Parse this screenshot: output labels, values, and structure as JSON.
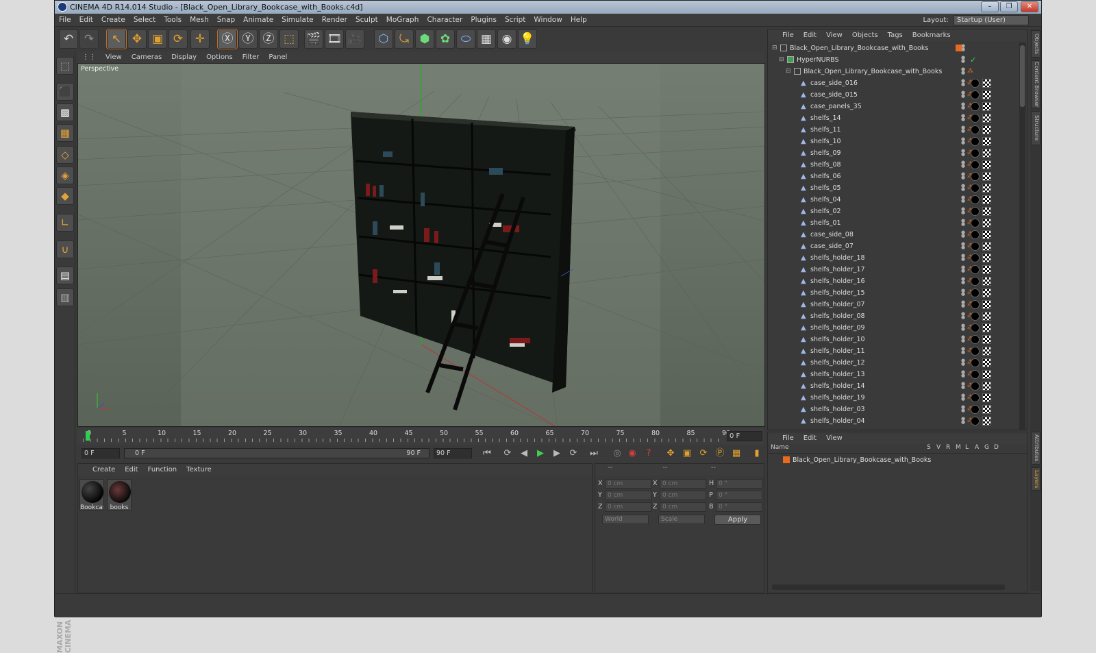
{
  "window": {
    "title": "CINEMA 4D R14.014 Studio - [Black_Open_Library_Bookcase_with_Books.c4d]",
    "controls": [
      "–",
      "❐",
      "✕"
    ]
  },
  "menubar": [
    "File",
    "Edit",
    "Create",
    "Select",
    "Tools",
    "Mesh",
    "Snap",
    "Animate",
    "Simulate",
    "Render",
    "Sculpt",
    "MoGraph",
    "Character",
    "Plugins",
    "Script",
    "Window",
    "Help"
  ],
  "layout": {
    "label": "Layout:",
    "value": "Startup (User)"
  },
  "toolbar": {
    "undo": "↶",
    "redo": "↷",
    "tools": [
      "↖",
      "✥",
      "▣",
      "⟳",
      "✛",
      "Ⓧ",
      "Ⓨ",
      "Ⓩ",
      "⬚",
      "🎬",
      "🎞",
      "🎥",
      "⬡",
      "⤿",
      "⬢",
      "✿",
      "⬭",
      "▦",
      "◉",
      "💡"
    ]
  },
  "viewport": {
    "menu": [
      "View",
      "Cameras",
      "Display",
      "Options",
      "Filter",
      "Panel"
    ],
    "label": "Perspective"
  },
  "timeline": {
    "ticks": [
      "0",
      "5",
      "10",
      "15",
      "20",
      "25",
      "30",
      "35",
      "40",
      "45",
      "50",
      "55",
      "60",
      "65",
      "70",
      "75",
      "80",
      "85",
      "90"
    ],
    "current_frame": "0 F",
    "start_field": "0 F",
    "range_start": "0 F",
    "range_end": "90 F",
    "end_field": "90 F"
  },
  "materials": {
    "menu": [
      "Create",
      "Edit",
      "Function",
      "Texture"
    ],
    "items": [
      {
        "name": "Bookcas"
      },
      {
        "name": "books"
      }
    ]
  },
  "coordinates": {
    "headers": [
      "--",
      "--",
      "--"
    ],
    "rows": [
      {
        "a": "X",
        "av": "0 cm",
        "b": "X",
        "bv": "0 cm",
        "c": "H",
        "cv": "0 °"
      },
      {
        "a": "Y",
        "av": "0 cm",
        "b": "Y",
        "bv": "0 cm",
        "c": "P",
        "cv": "0 °"
      },
      {
        "a": "Z",
        "av": "0 cm",
        "b": "Z",
        "bv": "0 cm",
        "c": "B",
        "cv": "0 °"
      }
    ],
    "mode1": "World",
    "mode2": "Scale",
    "apply": "Apply"
  },
  "objects": {
    "menu": [
      "File",
      "Edit",
      "View",
      "Objects",
      "Tags",
      "Bookmarks"
    ],
    "items": [
      {
        "name": "Black_Open_Library_Bookcase_with_Books",
        "level": 0
      },
      {
        "name": "HyperNURBS",
        "level": 1
      },
      {
        "name": "Black_Open_Library_Bookcase_with_Books",
        "level": 2
      },
      {
        "name": "case_side_016",
        "level": 3
      },
      {
        "name": "case_side_015",
        "level": 3
      },
      {
        "name": "case_panels_35",
        "level": 3
      },
      {
        "name": "shelfs_14",
        "level": 3
      },
      {
        "name": "shelfs_11",
        "level": 3
      },
      {
        "name": "shelfs_10",
        "level": 3
      },
      {
        "name": "shelfs_09",
        "level": 3
      },
      {
        "name": "shelfs_08",
        "level": 3
      },
      {
        "name": "shelfs_06",
        "level": 3
      },
      {
        "name": "shelfs_05",
        "level": 3
      },
      {
        "name": "shelfs_04",
        "level": 3
      },
      {
        "name": "shelfs_02",
        "level": 3
      },
      {
        "name": "shelfs_01",
        "level": 3
      },
      {
        "name": "case_side_08",
        "level": 3
      },
      {
        "name": "case_side_07",
        "level": 3
      },
      {
        "name": "shelfs_holder_18",
        "level": 3
      },
      {
        "name": "shelfs_holder_17",
        "level": 3
      },
      {
        "name": "shelfs_holder_16",
        "level": 3
      },
      {
        "name": "shelfs_holder_15",
        "level": 3
      },
      {
        "name": "shelfs_holder_07",
        "level": 3
      },
      {
        "name": "shelfs_holder_08",
        "level": 3
      },
      {
        "name": "shelfs_holder_09",
        "level": 3
      },
      {
        "name": "shelfs_holder_10",
        "level": 3
      },
      {
        "name": "shelfs_holder_11",
        "level": 3
      },
      {
        "name": "shelfs_holder_12",
        "level": 3
      },
      {
        "name": "shelfs_holder_13",
        "level": 3
      },
      {
        "name": "shelfs_holder_14",
        "level": 3
      },
      {
        "name": "shelfs_holder_19",
        "level": 3
      },
      {
        "name": "shelfs_holder_03",
        "level": 3
      },
      {
        "name": "shelfs_holder_04",
        "level": 3
      }
    ]
  },
  "layers": {
    "menu": [
      "File",
      "Edit",
      "View"
    ],
    "columns": [
      "Name",
      "S",
      "V",
      "R",
      "M",
      "L",
      "A",
      "G",
      "D"
    ],
    "items": [
      {
        "name": "Black_Open_Library_Bookcase_with_Books"
      }
    ]
  },
  "side_tabs": [
    "Objects",
    "Content Browser",
    "Structure",
    "Attributes",
    "Layers"
  ],
  "branding": "MAXON CINEMA 4D",
  "colors": {
    "accent": "#e86a1e",
    "viewport": "#6b7569",
    "panel": "#3a3a3a"
  }
}
